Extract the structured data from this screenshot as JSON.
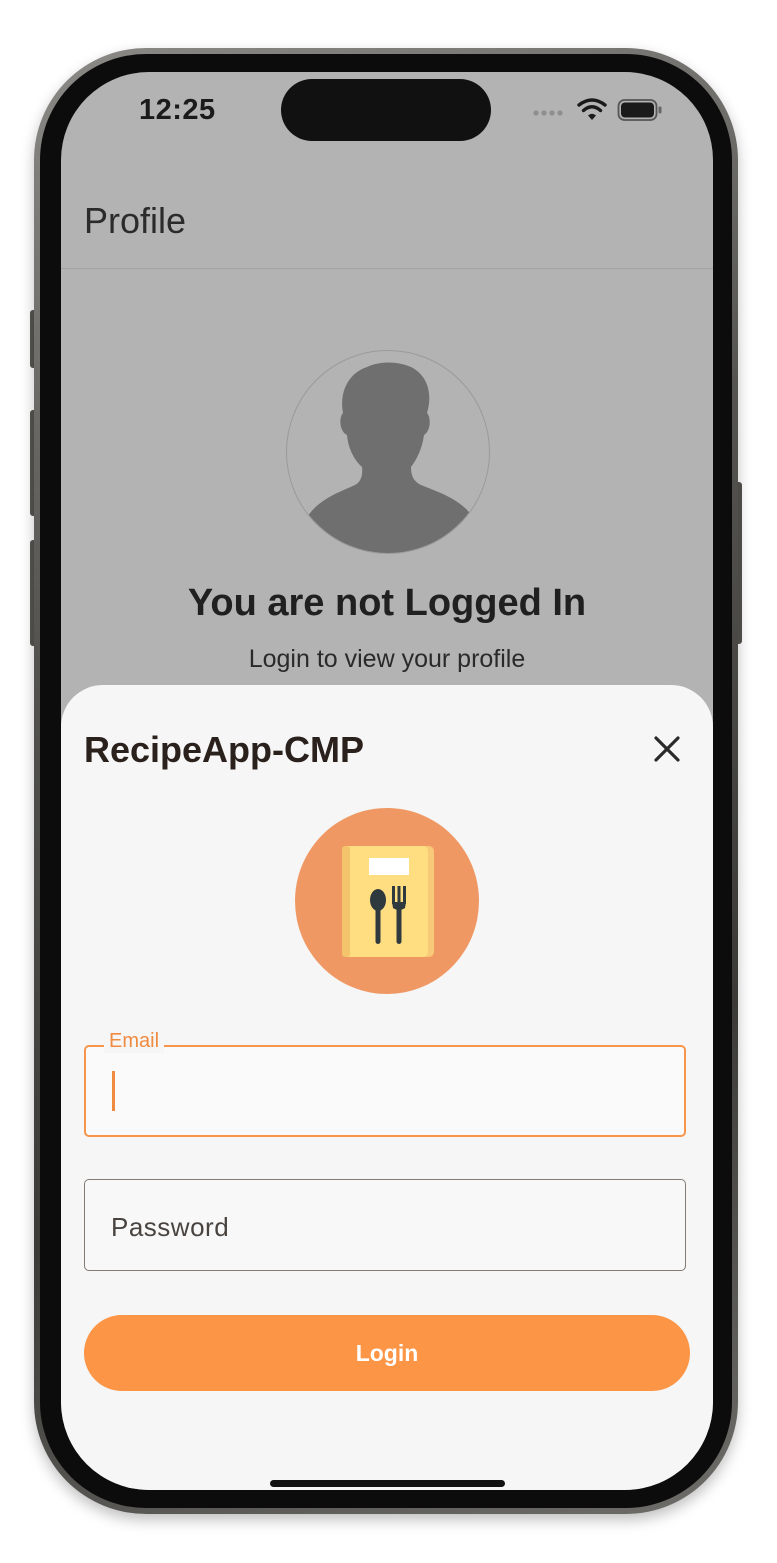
{
  "status_bar": {
    "time": "12:25",
    "signal_icon": "signal-dots-icon",
    "wifi_icon": "wifi-icon",
    "battery_icon": "battery-icon"
  },
  "profile": {
    "title": "Profile",
    "avatar_icon": "person-silhouette-icon",
    "heading": "You are not Logged In",
    "subtitle": "Login to view your profile"
  },
  "login_sheet": {
    "title": "RecipeApp-CMP",
    "close_icon": "close-icon",
    "logo_icon": "recipe-book-icon",
    "email": {
      "label": "Email",
      "value": ""
    },
    "password": {
      "placeholder": "Password",
      "value": ""
    },
    "login_label": "Login"
  },
  "colors": {
    "accent": "#fc9546",
    "logo_bg": "#ef9863",
    "sheet_bg": "#f6f6f6",
    "scrim_bg": "#b3b3b3"
  }
}
